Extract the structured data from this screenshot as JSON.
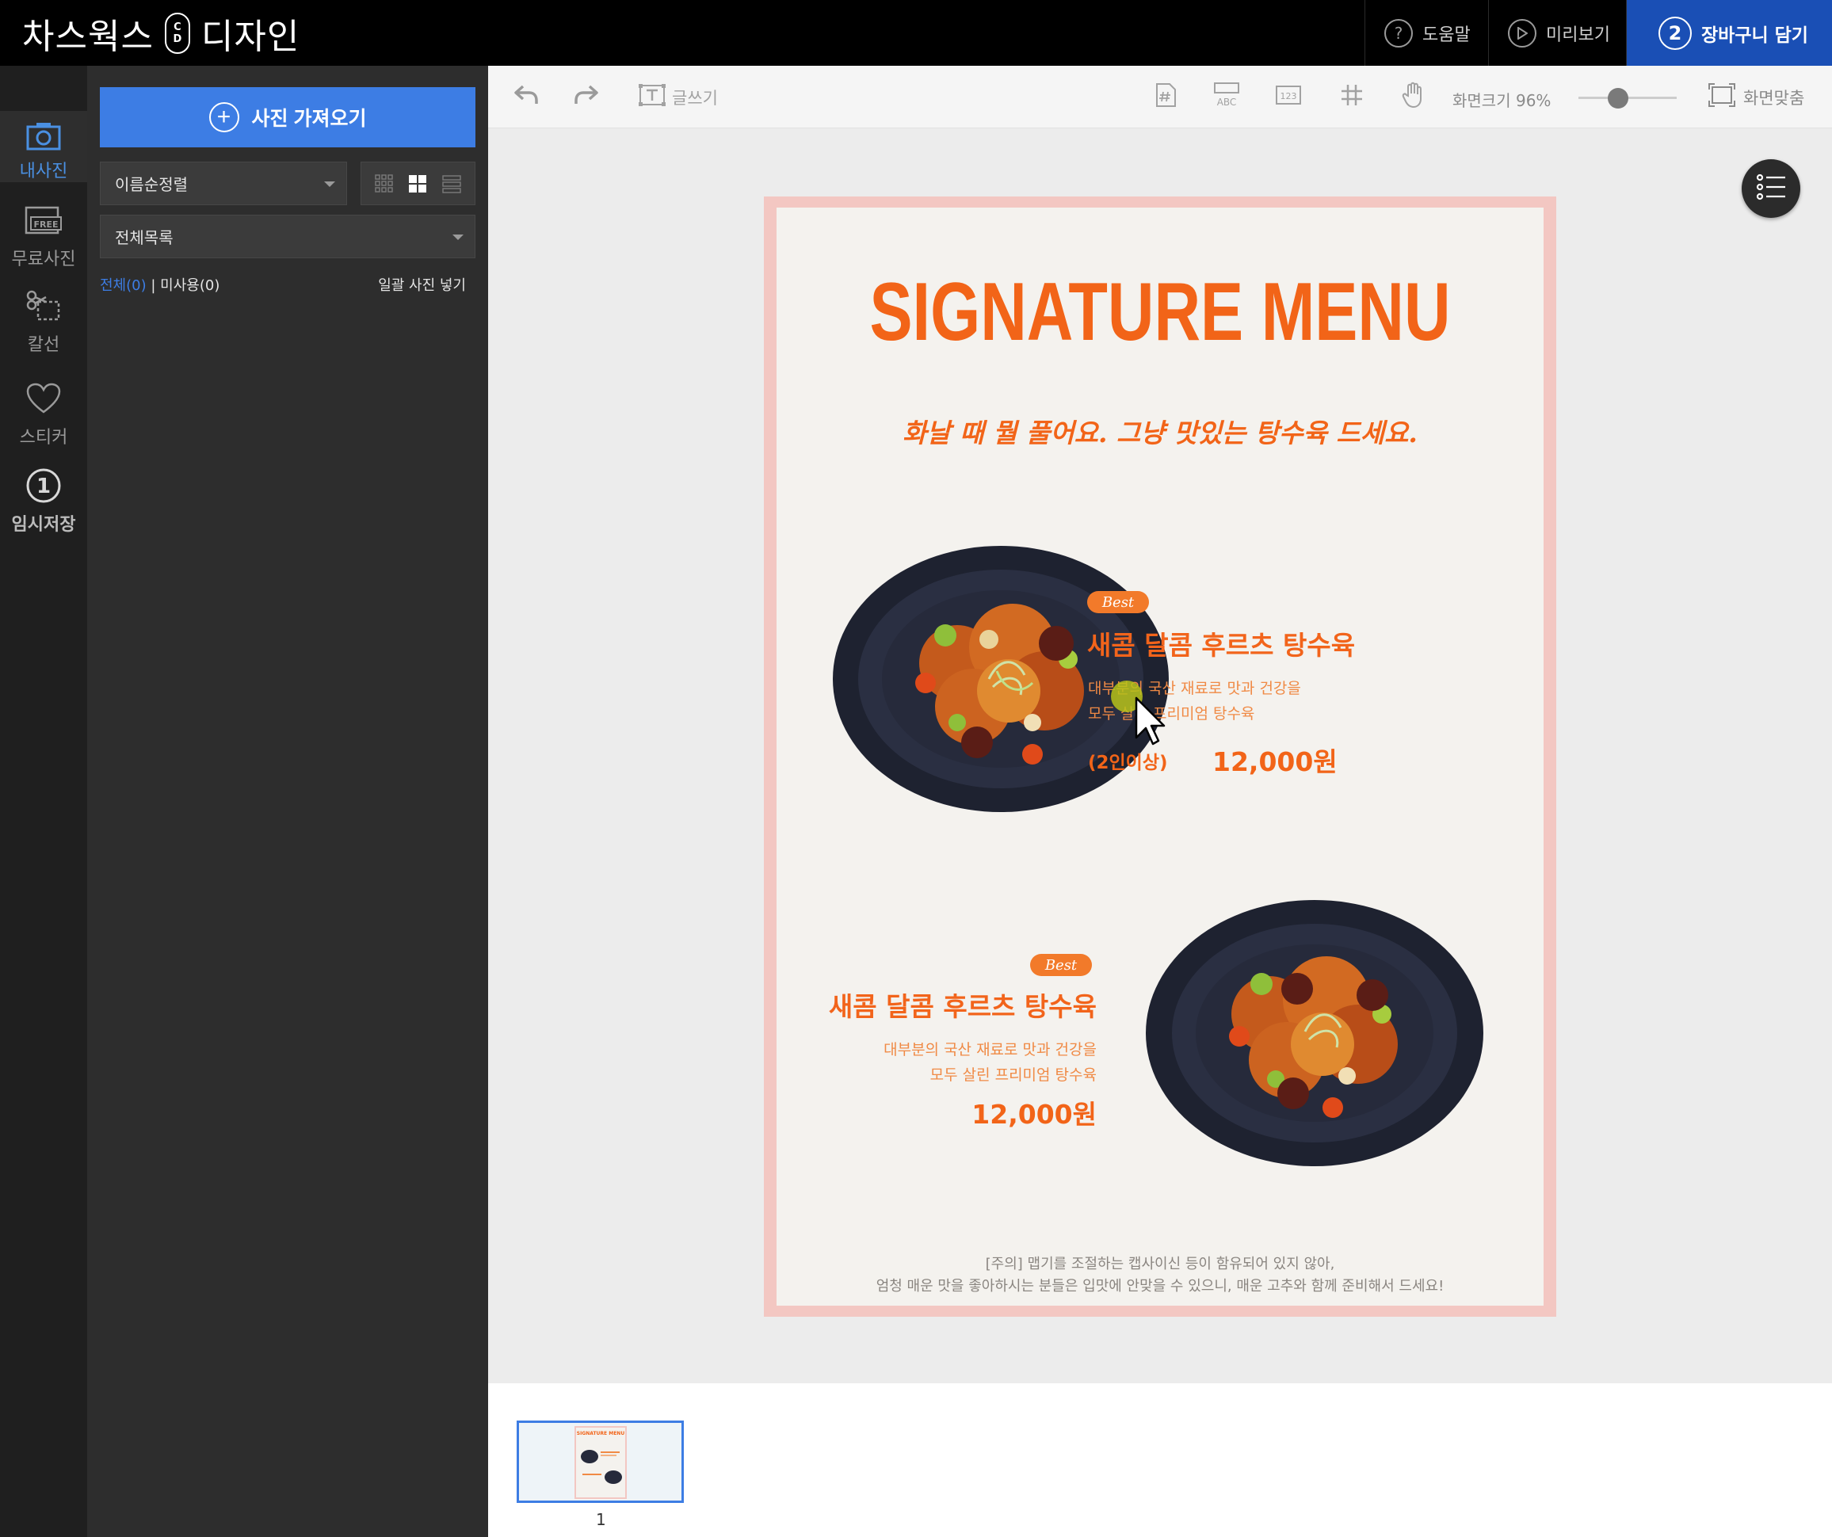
{
  "app": {
    "brand_name": "차스웍스",
    "brand_logo_letters": [
      "C",
      "D"
    ],
    "brand_suffix": "디자인"
  },
  "topbar": {
    "help_label": "도움말",
    "preview_label": "미리보기",
    "cart_step": "2",
    "cart_label": "장바구니 담기"
  },
  "rail": {
    "items": [
      {
        "label": "내사진",
        "icon": "camera-icon",
        "active": true
      },
      {
        "label": "무료사진",
        "icon": "free-photo-icon",
        "active": false
      },
      {
        "label": "칼선",
        "icon": "scissors-icon",
        "active": false
      },
      {
        "label": "스티커",
        "icon": "heart-icon",
        "active": false
      },
      {
        "label": "임시저장",
        "icon": "temp-save-icon",
        "badge": "1",
        "active": false
      }
    ]
  },
  "panel": {
    "import_label": "사진 가져오기",
    "sort_value": "이름순정렬",
    "list_value": "전체목록",
    "filter_all": "전체(0)",
    "filter_separator": "|",
    "filter_unused": "미사용(0)",
    "bulk_insert": "일괄 사진 넣기"
  },
  "toolbar": {
    "text_tool_label": "글쓰기",
    "zoom_label": "화면크기",
    "zoom_value": "96%",
    "zoom_fraction": 0.4,
    "fit_label": "화면맞춤"
  },
  "poster": {
    "title": "SIGNATURE MENU",
    "subtitle": "화날 때 뭘 풀어요. 그냥 맛있는 탕수육 드세요.",
    "items": [
      {
        "badge": "Best",
        "name": "새콤 달콤 후르츠 탕수육",
        "desc_line1": "대부분의 국산 재료로 맛과 건강을",
        "desc_line2": "모두 살린 프리미엄 탕수육",
        "note": "(2인이상)",
        "price": "12,000원"
      },
      {
        "badge": "Best",
        "name": "새콤 달콤 후르츠 탕수육",
        "desc_line1": "대부분의 국산 재료로 맛과 건강을",
        "desc_line2": "모두 살린 프리미엄 탕수육",
        "price": "12,000원"
      }
    ],
    "footer_line1": "[주의] 맵기를 조절하는 캡사이신 등이 함유되어 있지 않아,",
    "footer_line2": "엄청 매운 맛을 좋아하시는 분들은 입맛에 안맞을 수 있으니, 매운 고추와 함께 준비해서 드세요!"
  },
  "pages": {
    "thumb_title": "SIGNATURE MENU",
    "page_number": "1"
  },
  "colors": {
    "accent_blue": "#3d7de4",
    "cart_blue": "#1a4fb5",
    "poster_orange": "#f26418",
    "poster_border": "#f3c7c2"
  }
}
